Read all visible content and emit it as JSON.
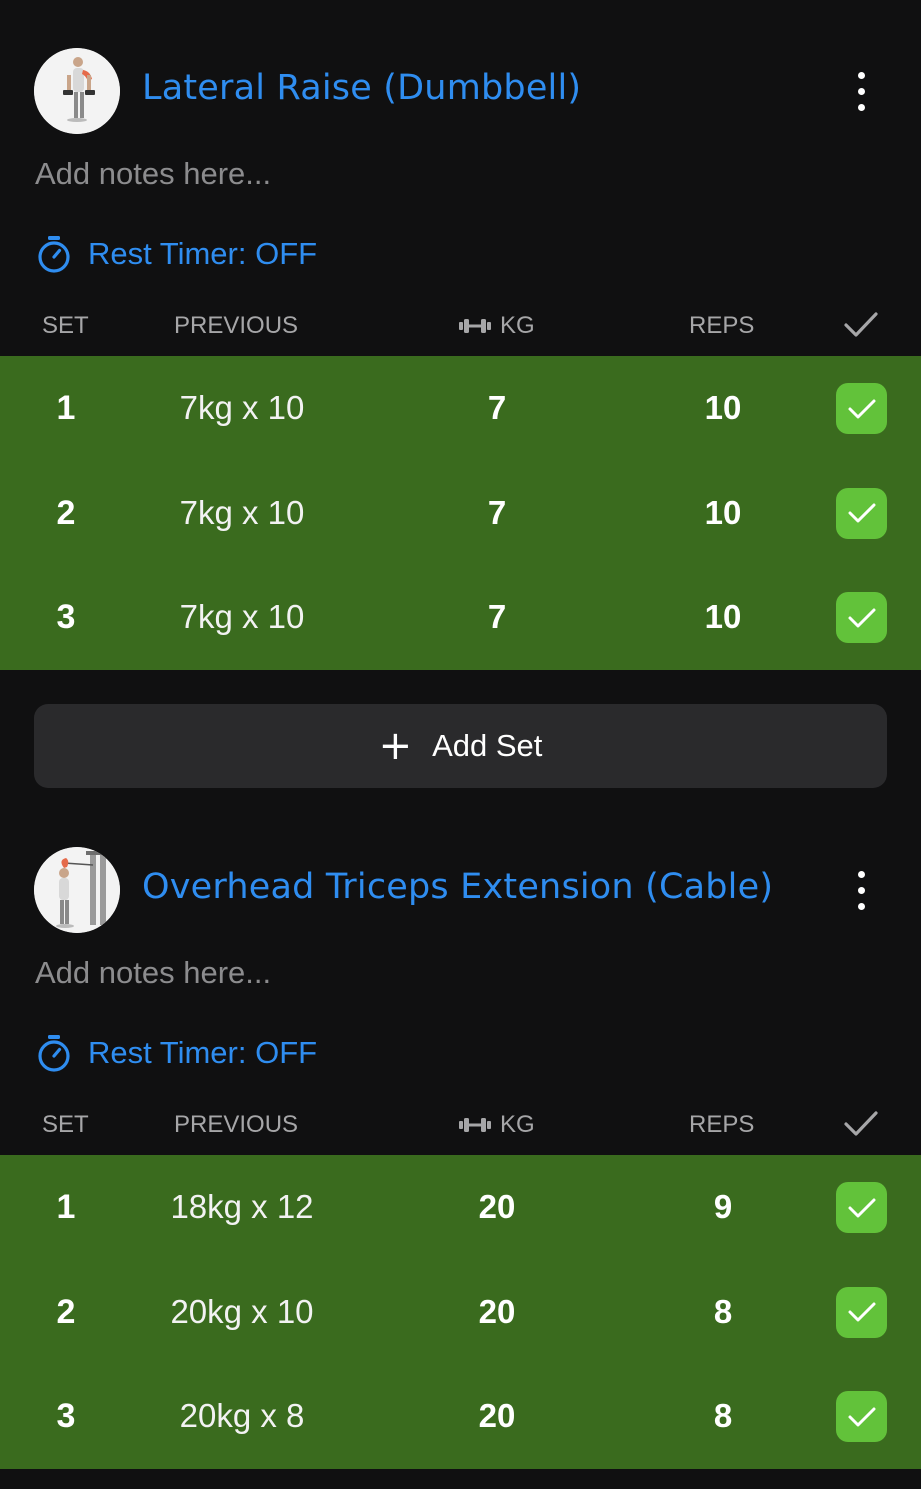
{
  "columns": {
    "set": "SET",
    "previous": "PREVIOUS",
    "kg": "KG",
    "reps": "REPS",
    "kg_icon": "dumbbell-icon",
    "done_icon": "checkmark-icon"
  },
  "colors": {
    "accent": "#2f8df0",
    "completed_row": "#3a6b1e",
    "check": "#62c23a",
    "background": "#101011"
  },
  "exercises": [
    {
      "title": "Lateral Raise (Dumbbell)",
      "notes_placeholder": "Add notes here...",
      "rest_timer": "Rest Timer: OFF",
      "sets": [
        {
          "set": "1",
          "previous": "7kg x 10",
          "kg": "7",
          "reps": "10",
          "done": true
        },
        {
          "set": "2",
          "previous": "7kg x 10",
          "kg": "7",
          "reps": "10",
          "done": true
        },
        {
          "set": "3",
          "previous": "7kg x 10",
          "kg": "7",
          "reps": "10",
          "done": true
        }
      ],
      "add_set_label": "Add Set"
    },
    {
      "title": "Overhead Triceps Extension (Cable)",
      "notes_placeholder": "Add notes here...",
      "rest_timer": "Rest Timer: OFF",
      "sets": [
        {
          "set": "1",
          "previous": "18kg x 12",
          "kg": "20",
          "reps": "9",
          "done": true
        },
        {
          "set": "2",
          "previous": "20kg x 10",
          "kg": "20",
          "reps": "8",
          "done": true
        },
        {
          "set": "3",
          "previous": "20kg x 8",
          "kg": "20",
          "reps": "8",
          "done": true
        }
      ]
    }
  ]
}
